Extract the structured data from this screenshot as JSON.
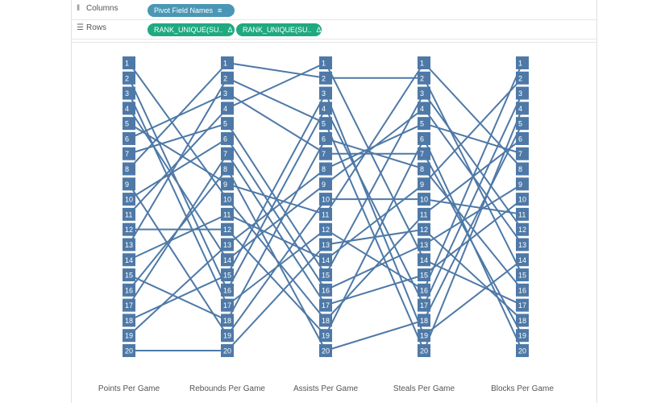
{
  "shelves": {
    "columns": {
      "label": "Columns",
      "icon": "columns-icon",
      "pill": "Pivot Field Names",
      "pill_icon": "sort-icon"
    },
    "rows": {
      "label": "Rows",
      "icon": "rows-icon",
      "pills": [
        "RANK_UNIQUE(SU..",
        "RANK_UNIQUE(SU.."
      ],
      "pill_icon": "delta-icon"
    }
  },
  "colors": {
    "line": "#4e79a7",
    "box": "#4e79a7",
    "box_text": "#ffffff",
    "columns_pill": "#4a97b5",
    "rows_pill": "#1fa97f"
  },
  "chart_data": {
    "type": "line",
    "categories": [
      "Points Per Game",
      "Rebounds Per Game",
      "Assists Per Game",
      "Steals Per Game",
      "Blocks Per Game"
    ],
    "ranks": [
      1,
      2,
      3,
      4,
      5,
      6,
      7,
      8,
      9,
      10,
      11,
      12,
      13,
      14,
      15,
      16,
      17,
      18,
      19,
      20
    ],
    "y_reversed": true,
    "ylim": [
      1,
      20
    ],
    "grid": false,
    "legend": "none",
    "series": [
      {
        "values": [
          1,
          10,
          18,
          11,
          6
        ]
      },
      {
        "values": [
          2,
          16,
          4,
          17,
          3
        ]
      },
      {
        "values": [
          3,
          17,
          12,
          16,
          1
        ]
      },
      {
        "values": [
          4,
          14,
          9,
          4,
          13
        ]
      },
      {
        "values": [
          5,
          9,
          11,
          1,
          8
        ]
      },
      {
        "values": [
          6,
          3,
          7,
          7,
          19
        ]
      },
      {
        "values": [
          7,
          5,
          15,
          3,
          12
        ]
      },
      {
        "values": [
          8,
          1,
          2,
          2,
          15
        ]
      },
      {
        "values": [
          9,
          19,
          10,
          10,
          11
        ]
      },
      {
        "values": [
          10,
          6,
          16,
          13,
          9
        ]
      },
      {
        "values": [
          11,
          4,
          1,
          14,
          17
        ]
      },
      {
        "values": [
          12,
          12,
          19,
          6,
          20
        ]
      },
      {
        "values": [
          13,
          2,
          5,
          20,
          4
        ]
      },
      {
        "values": [
          14,
          11,
          14,
          9,
          2
        ]
      },
      {
        "values": [
          15,
          18,
          6,
          8,
          16
        ]
      },
      {
        "values": [
          16,
          8,
          20,
          18,
          5
        ]
      },
      {
        "values": [
          17,
          7,
          17,
          15,
          10
        ]
      },
      {
        "values": [
          18,
          15,
          3,
          19,
          14
        ]
      },
      {
        "values": [
          19,
          13,
          8,
          5,
          7
        ]
      },
      {
        "values": [
          20,
          20,
          13,
          12,
          18
        ]
      }
    ]
  }
}
